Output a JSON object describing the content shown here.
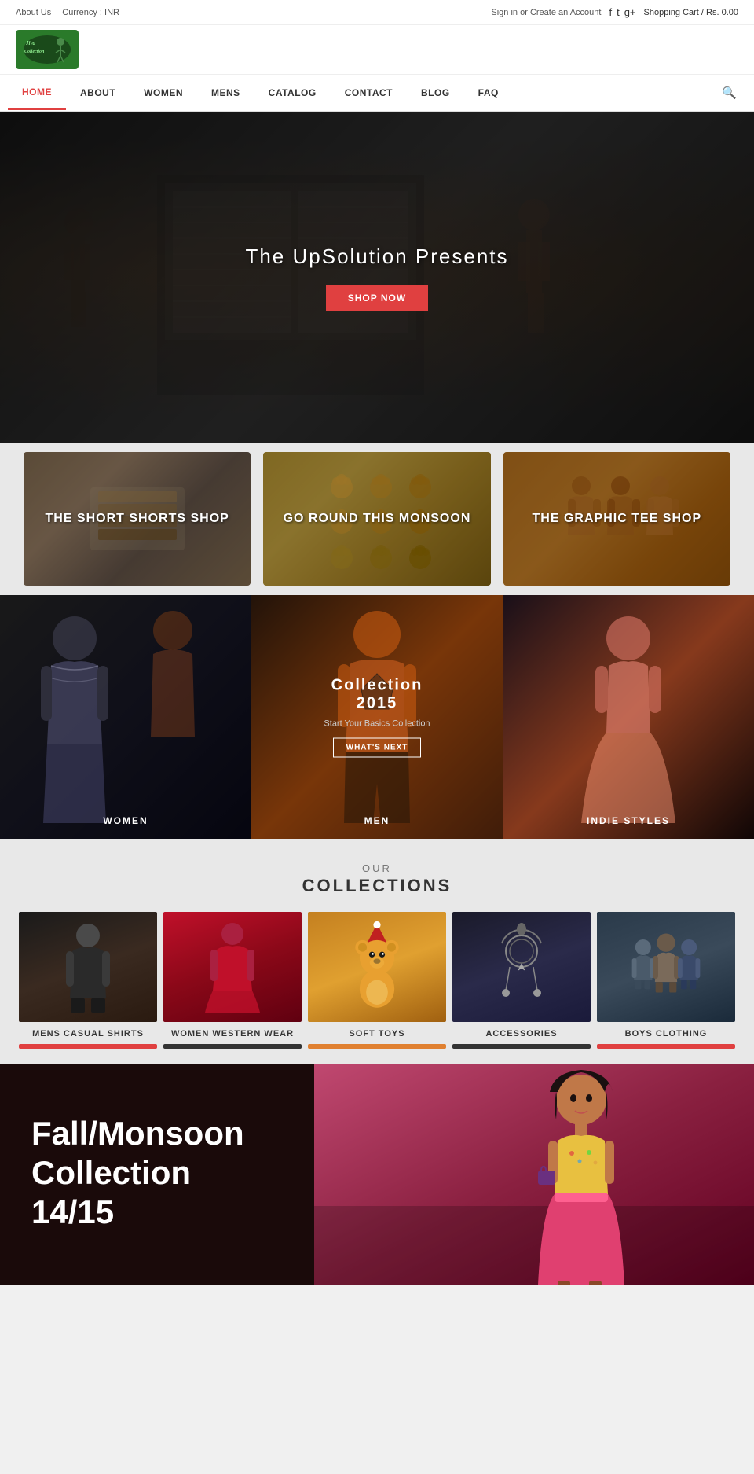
{
  "topbar": {
    "about": "About Us",
    "currency": "Currency : INR",
    "signin": "Sign in",
    "or": " or ",
    "create_account": "Create an Account",
    "cart": "Shopping Cart",
    "cart_value": "/ Rs. 0.00",
    "social_fb": "f",
    "social_tw": "t",
    "social_gp": "g+"
  },
  "header": {
    "logo_alt": "Jiva Collection",
    "auth_text": "Sign in or Create an Account"
  },
  "nav": {
    "items": [
      {
        "label": "HOME",
        "active": true
      },
      {
        "label": "ABOUT",
        "active": false
      },
      {
        "label": "WOMEN",
        "active": false
      },
      {
        "label": "MENS",
        "active": false
      },
      {
        "label": "CATALOG",
        "active": false
      },
      {
        "label": "CONTACT",
        "active": false
      },
      {
        "label": "BLOG",
        "active": false
      },
      {
        "label": "FAQ",
        "active": false
      }
    ]
  },
  "hero": {
    "title": "The UpSolution Presents",
    "button": "SHOP NOW"
  },
  "featured": {
    "cards": [
      {
        "title": "THE SHORT SHORTS SHOP"
      },
      {
        "title": "GO ROUND THIS MONSOON"
      },
      {
        "title": "THE GRAPHIC TEE SHOP"
      }
    ]
  },
  "slider": {
    "center_title": "Collection 2015",
    "center_sub": "Start Your Basics Collection",
    "button": "WHAT'S NEXT",
    "panels": [
      {
        "label": "WOMEN"
      },
      {
        "label": "MEN"
      },
      {
        "label": "INDIE STYLES"
      }
    ]
  },
  "collections": {
    "heading": "OUR",
    "title": "COLLECTIONS",
    "items": [
      {
        "label": "MENS CASUAL\nSHIRTS",
        "label_display": "MENS CASUAL SHIRTS"
      },
      {
        "label": "WOMEN WESTERN\nWEAR",
        "label_display": "WOMEN WESTERN WEAR"
      },
      {
        "label": "SOFT TOYS",
        "label_display": "SOFT TOYS"
      },
      {
        "label": "ACCESSORIES",
        "label_display": "ACCESSORIES"
      },
      {
        "label": "BOYS CLOTHING",
        "label_display": "BOYS CLOTHING"
      }
    ]
  },
  "promo": {
    "line1": "Fall/Monsoon",
    "line2": "Collection",
    "line3": "14/15"
  },
  "colors": {
    "accent_red": "#e04040",
    "accent_orange": "#e08030",
    "dark": "#1a1a1a",
    "text_dark": "#333333"
  }
}
